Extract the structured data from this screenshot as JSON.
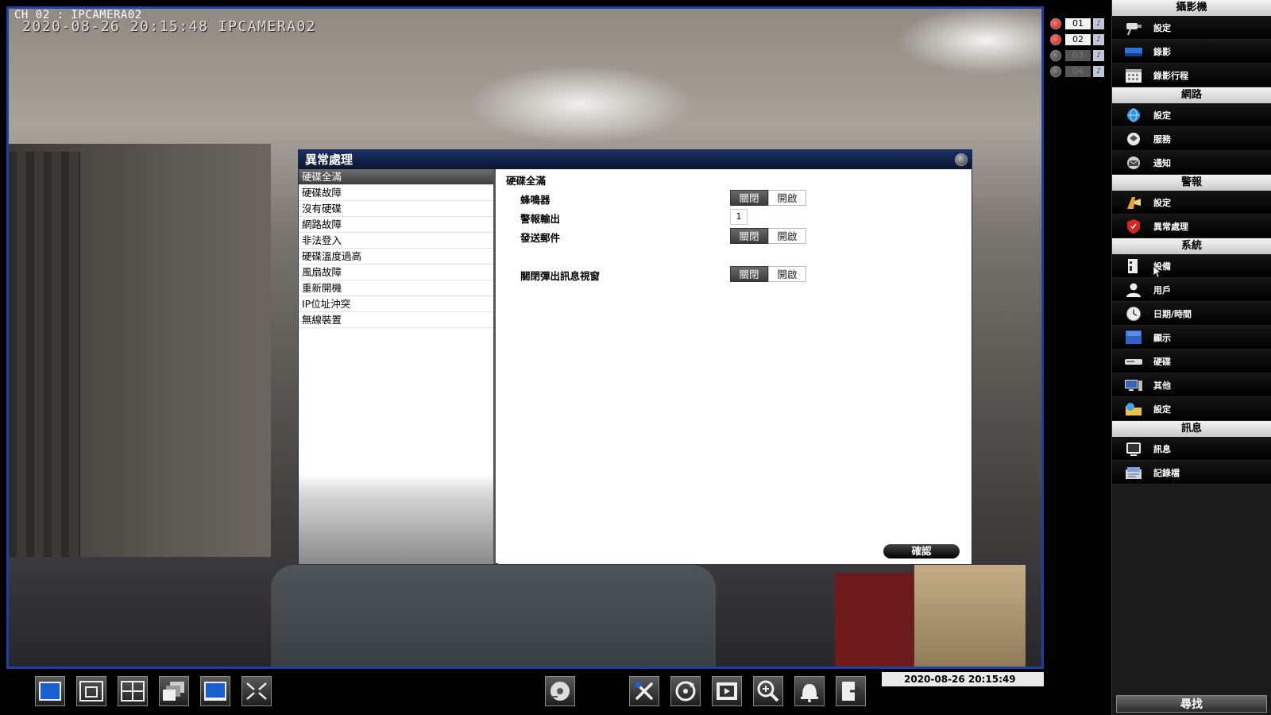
{
  "video": {
    "camera_title": "CH 02 : IPCAMERA02",
    "osd_timestamp": "2020-08-26 20:15:48 IPCAMERA02"
  },
  "channels": [
    {
      "num": "01",
      "state": "recording"
    },
    {
      "num": "02",
      "state": "recording"
    },
    {
      "num": "03",
      "state": "off"
    },
    {
      "num": "04",
      "state": "off"
    }
  ],
  "menu": {
    "sections": [
      {
        "header": "攝影機",
        "items": [
          {
            "label": "設定",
            "icon": "camera-settings-icon"
          },
          {
            "label": "錄影",
            "icon": "record-icon"
          },
          {
            "label": "錄影行程",
            "icon": "schedule-icon"
          }
        ]
      },
      {
        "header": "網路",
        "items": [
          {
            "label": "設定",
            "icon": "network-settings-icon"
          },
          {
            "label": "服務",
            "icon": "service-icon"
          },
          {
            "label": "通知",
            "icon": "notification-icon"
          }
        ]
      },
      {
        "header": "警報",
        "items": [
          {
            "label": "設定",
            "icon": "alarm-settings-icon"
          },
          {
            "label": "異常處理",
            "icon": "shield-icon"
          }
        ]
      },
      {
        "header": "系統",
        "items": [
          {
            "label": "設備",
            "icon": "device-icon"
          },
          {
            "label": "用戶",
            "icon": "user-icon"
          },
          {
            "label": "日期/時間",
            "icon": "clock-icon"
          },
          {
            "label": "顯示",
            "icon": "display-icon"
          },
          {
            "label": "硬碟",
            "icon": "hard-disk-icon"
          },
          {
            "label": "其他",
            "icon": "monitor-icon"
          },
          {
            "label": "設定",
            "icon": "folder-icon"
          }
        ]
      },
      {
        "header": "訊息",
        "items": [
          {
            "label": "訊息",
            "icon": "info-icon"
          },
          {
            "label": "記錄檔",
            "icon": "log-icon"
          }
        ]
      }
    ],
    "search_label": "尋找"
  },
  "dialog": {
    "title": "異常處理",
    "list": [
      "硬碟全滿",
      "硬碟故障",
      "沒有硬碟",
      "網路故障",
      "非法登入",
      "硬碟溫度過高",
      "風扇故障",
      "重新開機",
      "IP位址沖突",
      "無線裝置"
    ],
    "selected_index": 0,
    "section_title": "硬碟全滿",
    "settings": {
      "buzzer_label": "蜂鳴器",
      "alarm_output_label": "警報輸出",
      "alarm_output_value": "1",
      "send_email_label": "發送郵件",
      "close_popup_label": "關閉彈出訊息視窗",
      "off_label": "關閉",
      "on_label": "開啟"
    },
    "confirm_label": "確認"
  },
  "statusbar": {
    "datetime": "2020-08-26 20:15:49"
  },
  "colors": {
    "video_border": "#1f3fa8",
    "dialog_title_bg": "#1b2f66",
    "record_red": "#c01a12"
  }
}
